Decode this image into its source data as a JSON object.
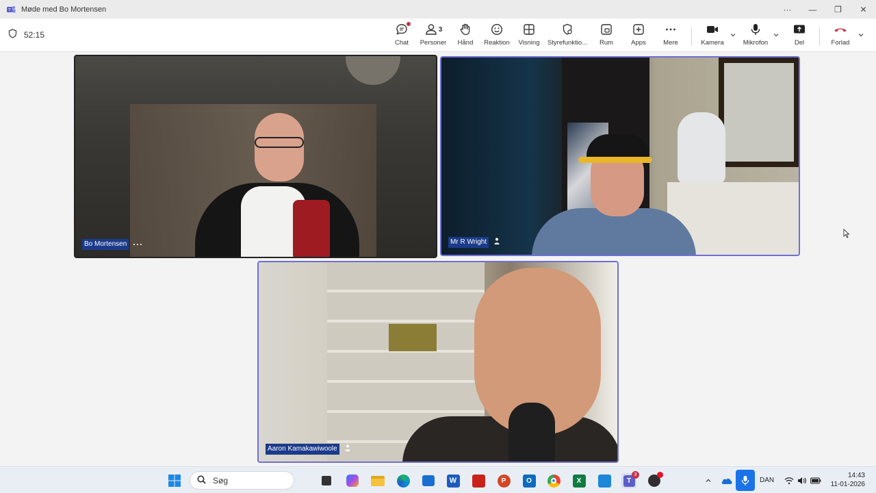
{
  "window": {
    "title": "Møde med Bo Mortensen",
    "controls": {
      "menu": "···",
      "minimize": "—",
      "restore": "❐",
      "close": "✕"
    }
  },
  "toolbar": {
    "timer": "52:15",
    "chat_label": "Chat",
    "people_label": "Personer",
    "people_count": "3",
    "hand_label": "Hånd",
    "reaction_label": "Reaktion",
    "view_label": "Visning",
    "controls_label": "Styrefunktio...",
    "room_label": "Rum",
    "apps_label": "Apps",
    "more_label": "Mere",
    "camera_label": "Kamera",
    "mic_label": "Mikrofon",
    "share_label": "Del",
    "leave_label": "Forlad"
  },
  "participants": [
    {
      "name": "Bo Mortensen",
      "more": "···"
    },
    {
      "name": "Mr R Wright"
    },
    {
      "name": "Aaron Kamakawiwoole"
    }
  ],
  "taskbar": {
    "search_placeholder": "Søg",
    "teams_badge": "3",
    "language": "DAN",
    "time": "14:43",
    "date": "11-01-2026"
  },
  "colors": {
    "accent": "#6264a7",
    "leave": "#c4314b",
    "name_tag": "#1b3b8a",
    "speaker_border": "#6f6fd6"
  }
}
